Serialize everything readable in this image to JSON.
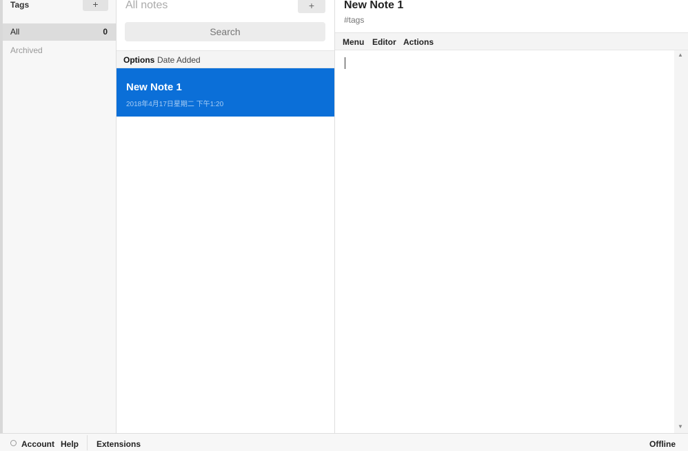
{
  "tags_panel": {
    "title": "Tags",
    "add_label": "+",
    "items": [
      {
        "label": "All",
        "count": "0"
      },
      {
        "label": "Archived"
      }
    ]
  },
  "notes_panel": {
    "title": "All notes",
    "add_label": "+",
    "search_placeholder": "Search",
    "options_label": "Options",
    "sort_value": "Date Added",
    "notes": [
      {
        "title": "New Note 1",
        "date": "2018年4月17日星期二 下午1:20"
      }
    ]
  },
  "editor": {
    "title": "New Note 1",
    "tags_placeholder": "#tags",
    "menu": [
      "Menu",
      "Editor",
      "Actions"
    ]
  },
  "footer": {
    "account": "Account",
    "help": "Help",
    "extensions": "Extensions",
    "status": "Offline"
  },
  "colors": {
    "selected_note_bg": "#0b6fd8",
    "panel_bg": "#f7f7f7"
  }
}
